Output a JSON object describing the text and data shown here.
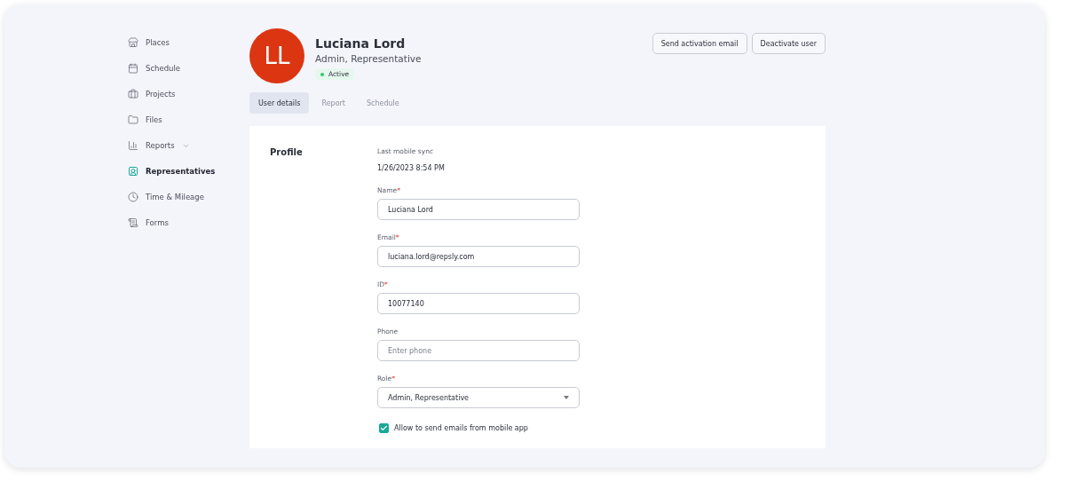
{
  "sidebar": {
    "items": [
      {
        "label": "Places",
        "selected": false,
        "has_menu": false
      },
      {
        "label": "Schedule",
        "selected": false,
        "has_menu": false
      },
      {
        "label": "Projects",
        "selected": false,
        "has_menu": false
      },
      {
        "label": "Files",
        "selected": false,
        "has_menu": false
      },
      {
        "label": "Reports",
        "selected": false,
        "has_menu": true
      },
      {
        "label": "Representatives",
        "selected": true,
        "has_menu": false
      },
      {
        "label": "Time & Mileage",
        "selected": false,
        "has_menu": false
      },
      {
        "label": "Forms",
        "selected": false,
        "has_menu": false
      }
    ]
  },
  "header": {
    "initials": "LL",
    "name": "Luciana Lord",
    "role": "Admin, Representative",
    "status": {
      "label": "Active",
      "color": "#2ecc71"
    },
    "buttons": [
      "Send activation email",
      "Deactivate user"
    ]
  },
  "tabs": [
    {
      "label": "User details",
      "selected": true
    },
    {
      "label": "Report",
      "selected": false
    },
    {
      "label": "Schedule",
      "selected": false
    }
  ],
  "profile": {
    "section_title": "Profile",
    "sync_label": "Last mobile sync",
    "sync_value": "1/26/2023 8:54 PM",
    "fields": [
      {
        "kind": "input",
        "label": "Name",
        "required_mark": "*",
        "value": "Luciana Lord"
      },
      {
        "kind": "input",
        "label": "Email",
        "required_mark": "*",
        "value": "luciana.lord@repsly.com"
      },
      {
        "kind": "input",
        "label": "ID",
        "required_mark": "*",
        "value": "10077140"
      },
      {
        "kind": "input",
        "label": "Phone",
        "placeholder": "Enter phone"
      },
      {
        "kind": "select",
        "label": "Role",
        "required_mark": "*",
        "value": "Admin, Representative"
      }
    ],
    "checkbox": {
      "label": "Allow to send emails from mobile app",
      "checked": true
    }
  }
}
